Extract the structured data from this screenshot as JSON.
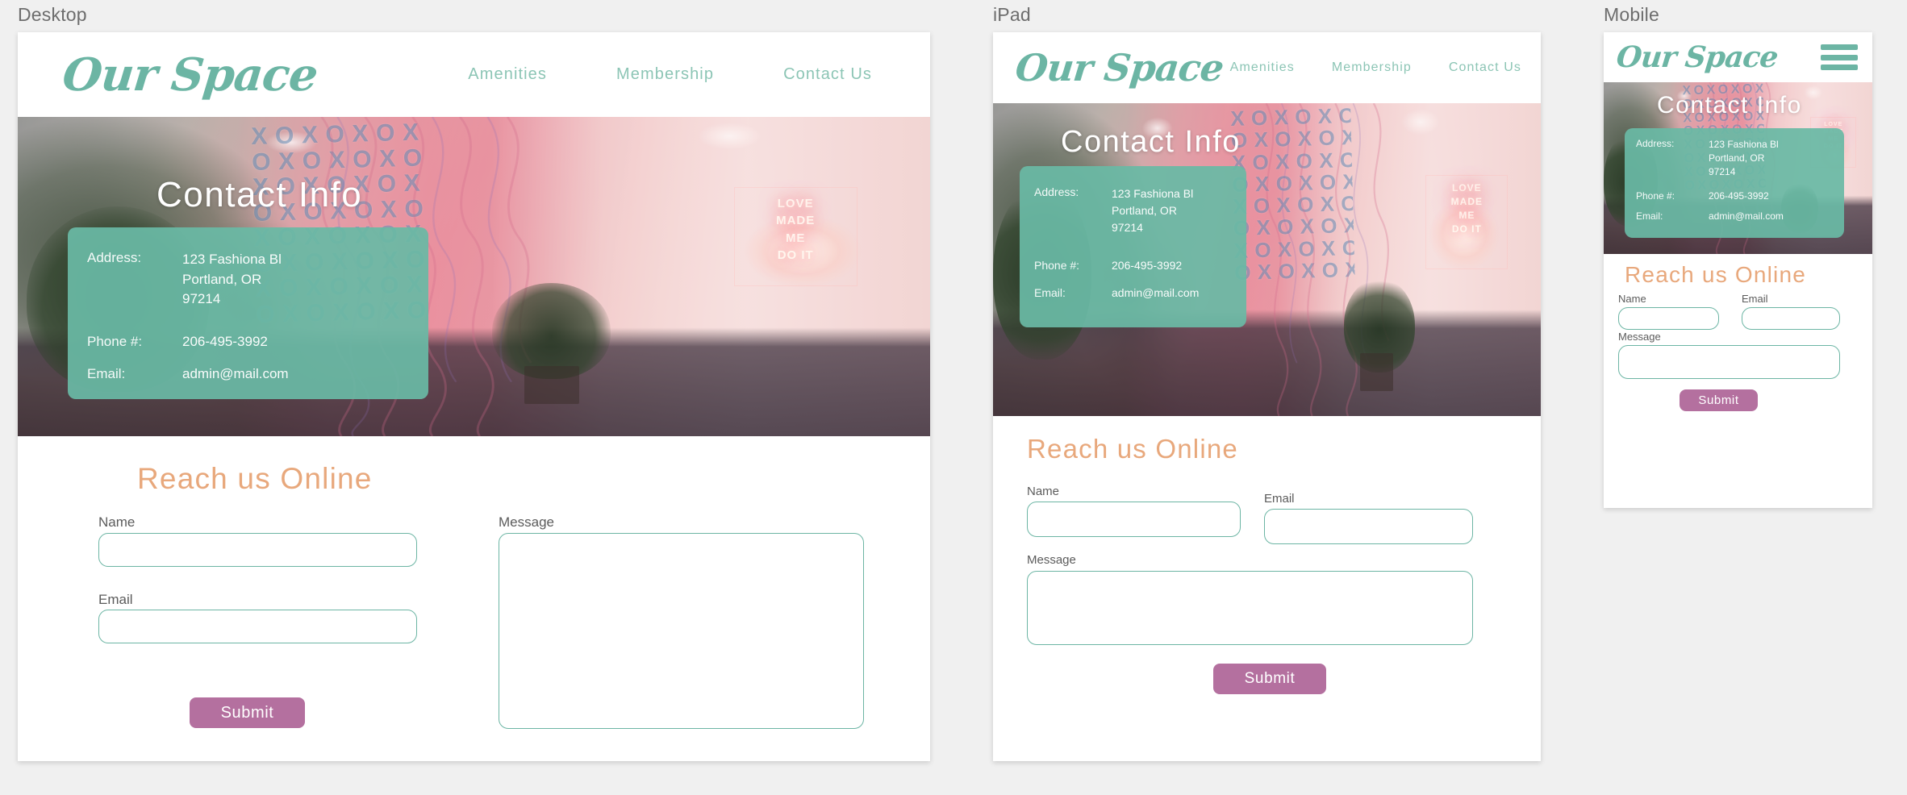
{
  "viewports": [
    {
      "label": "Desktop"
    },
    {
      "label": "iPad"
    },
    {
      "label": "Mobile"
    }
  ],
  "brand": {
    "logo_text": "Our Space",
    "logo_color": "#6cb5a4"
  },
  "nav": {
    "items": [
      {
        "label": "Amenities"
      },
      {
        "label": "Membership"
      },
      {
        "label": "Contact Us"
      }
    ],
    "link_color": "#8cc5b5",
    "menu_icon": "hamburger-icon"
  },
  "hero": {
    "title": "Contact Info",
    "image_alt": "Coworking lounge with pink XOXO mural, potted palms and neon sign",
    "neon_sign_text": "LOVE\nMADE\nME\nDO IT",
    "mural_glyphs": "XOXOXOX\nOXOXOXO\nXOXOXOX\nOXOXOXO\nXOXOXOX\nOXOXOXO\nXOXOXOX\nOXOXOXO"
  },
  "contact_card": {
    "background_color": "#69b9a5",
    "rows": [
      {
        "label": "Address:",
        "value": "123 Fashiona Bl\nPortland, OR\n97214"
      },
      {
        "label": "Phone #:",
        "value": "206-495-3992"
      },
      {
        "label": "Email:",
        "value": "admin@mail.com"
      }
    ]
  },
  "form": {
    "title": "Reach us Online",
    "title_color": "#e8a87c",
    "fields": [
      {
        "label": "Name",
        "value": "",
        "placeholder": ""
      },
      {
        "label": "Email",
        "value": "",
        "placeholder": ""
      },
      {
        "label": "Message",
        "value": "",
        "placeholder": ""
      }
    ],
    "submit_label": "Submit",
    "submit_color": "#b4709f",
    "input_border_color": "#6cb5a4"
  }
}
